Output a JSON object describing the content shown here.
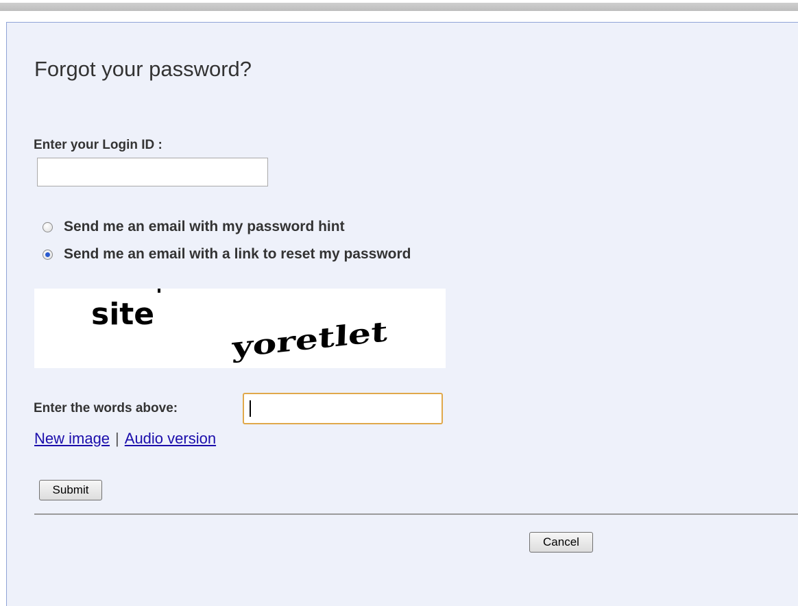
{
  "page": {
    "title": "Forgot your password?"
  },
  "login": {
    "label": "Enter your Login ID :",
    "value": ""
  },
  "options": [
    {
      "label": "Send me an email with my password hint",
      "checked": false
    },
    {
      "label": "Send me an email with a link to reset my password",
      "checked": true
    }
  ],
  "captcha": {
    "words": [
      "site",
      "yoretlet"
    ],
    "label": "Enter the words above:",
    "value": "",
    "new_image_link": "New image",
    "separator": "|",
    "audio_link": "Audio version"
  },
  "buttons": {
    "submit": "Submit",
    "cancel": "Cancel"
  },
  "colors": {
    "panel_background": "#eef1fa",
    "panel_border": "#8fa3d6",
    "link": "#1a0dab",
    "focus_border": "#e0a84a"
  }
}
